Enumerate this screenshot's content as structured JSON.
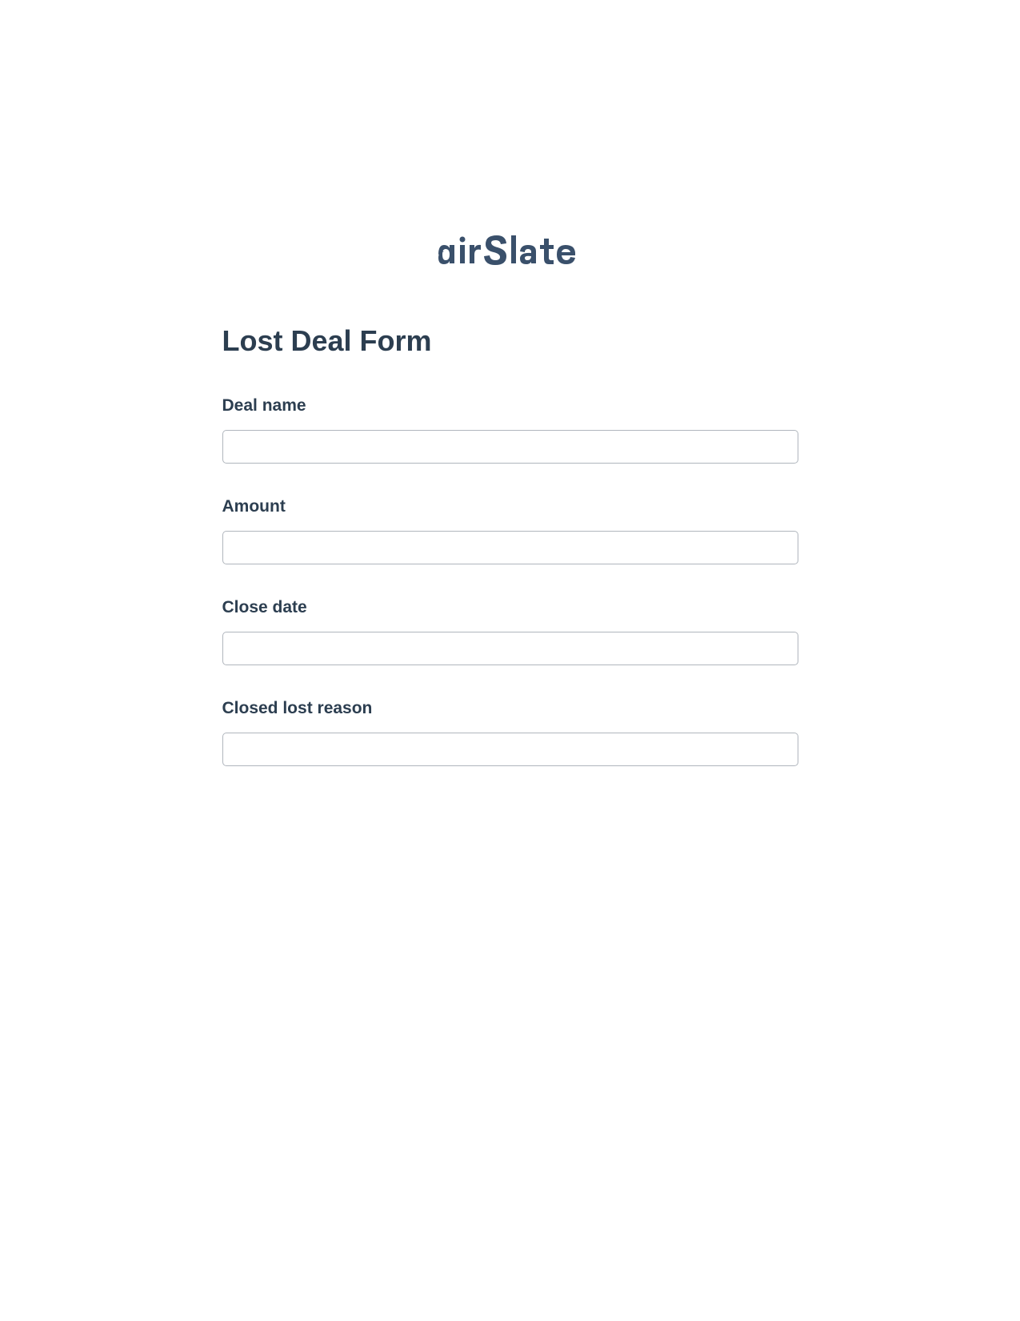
{
  "logo": {
    "brand": "airSlate",
    "color": "#2d4059"
  },
  "form": {
    "title": "Lost Deal Form",
    "fields": [
      {
        "label": "Deal name",
        "value": ""
      },
      {
        "label": "Amount",
        "value": ""
      },
      {
        "label": "Close date",
        "value": ""
      },
      {
        "label": "Closed lost reason",
        "value": ""
      }
    ]
  }
}
